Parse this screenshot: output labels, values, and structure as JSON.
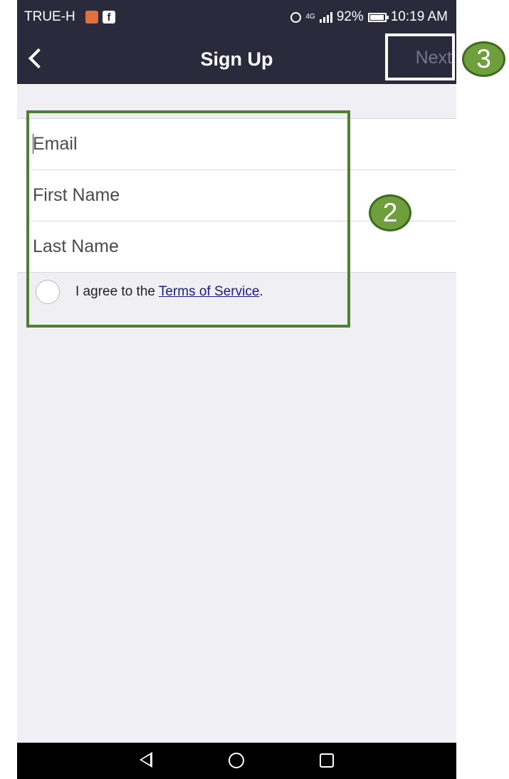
{
  "status_bar": {
    "carrier": "TRUE-H",
    "notification_icons": [
      "mail-notification-icon",
      "facebook-icon"
    ],
    "network": "4G",
    "battery": "92%",
    "time": "10:19 AM"
  },
  "nav": {
    "title": "Sign Up",
    "next_label": "Next"
  },
  "form": {
    "email_placeholder": "Email",
    "first_name_placeholder": "First Name",
    "last_name_placeholder": "Last Name",
    "terms_prefix": "I agree to the ",
    "terms_link": "Terms of Service",
    "terms_suffix": ".",
    "terms_checked": false
  },
  "annotations": {
    "form_badge": "2",
    "next_badge": "3",
    "color": "#507e32"
  },
  "colors": {
    "header": "#2b2a3d",
    "background": "#efeff4",
    "link": "#1a1a8f",
    "next_disabled": "#76758a"
  }
}
